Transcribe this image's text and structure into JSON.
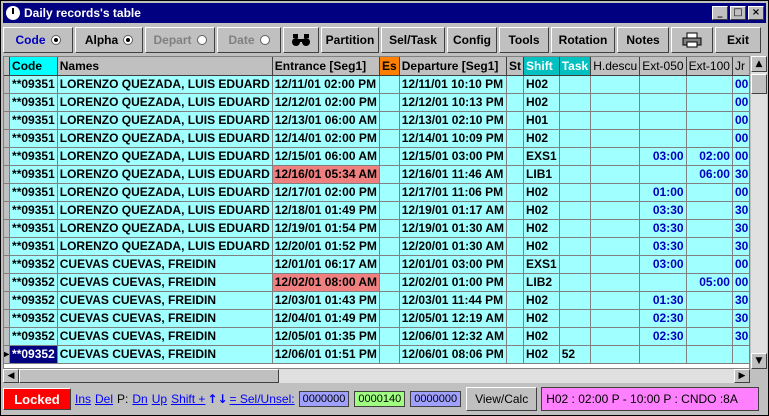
{
  "window": {
    "title": "Daily records's table",
    "min": "_",
    "max": "□",
    "close": "×"
  },
  "toolbar": {
    "code": "Code",
    "alpha": "Alpha",
    "depart": "Depart",
    "date": "Date",
    "partition": "Partition",
    "seltask": "Sel/Task",
    "config": "Config",
    "tools": "Tools",
    "rotation": "Rotation",
    "notes": "Notes",
    "exit": "Exit"
  },
  "columns": [
    "Code",
    "Names",
    "Entrance  [Seg1]",
    "Es",
    "Departure [Seg1]",
    "St",
    "Shift",
    "Task",
    "H.descu",
    "Ext-050",
    "Ext-100",
    "Jr"
  ],
  "rows": [
    {
      "code": "**09351",
      "name": "LORENZO QUEZADA, LUIS EDUARD",
      "entrance": "12/11/01 02:00 PM",
      "departure": "12/11/01 10:10 PM",
      "shift": "H02",
      "task": "",
      "ext050": "",
      "ext100": "",
      "jr": "00"
    },
    {
      "code": "**09351",
      "name": "LORENZO QUEZADA, LUIS EDUARD",
      "entrance": "12/12/01 02:00 PM",
      "departure": "12/12/01 10:13 PM",
      "shift": "H02",
      "task": "",
      "ext050": "",
      "ext100": "",
      "jr": "00"
    },
    {
      "code": "**09351",
      "name": "LORENZO QUEZADA, LUIS EDUARD",
      "entrance": "12/13/01 06:00 AM",
      "departure": "12/13/01 02:10 PM",
      "shift": "H01",
      "task": "",
      "ext050": "",
      "ext100": "",
      "jr": "00"
    },
    {
      "code": "**09351",
      "name": "LORENZO QUEZADA, LUIS EDUARD",
      "entrance": "12/14/01 02:00 PM",
      "departure": "12/14/01 10:09 PM",
      "shift": "H02",
      "task": "",
      "ext050": "",
      "ext100": "",
      "jr": "00"
    },
    {
      "code": "**09351",
      "name": "LORENZO QUEZADA, LUIS EDUARD",
      "entrance": "12/15/01 06:00 AM",
      "departure": "12/15/01 03:00 PM",
      "shift": "EXS1",
      "task": "",
      "ext050": "03:00",
      "ext100": "02:00",
      "jr": "00"
    },
    {
      "code": "**09351",
      "name": "LORENZO QUEZADA, LUIS EDUARD",
      "entrance": "12/16/01 05:34 AM",
      "entrance_alert": true,
      "departure": "12/16/01 11:46 AM",
      "shift": "LIB1",
      "task": "",
      "ext050": "",
      "ext100": "06:00",
      "jr": "30"
    },
    {
      "code": "**09351",
      "name": "LORENZO QUEZADA, LUIS EDUARD",
      "entrance": "12/17/01 02:00 PM",
      "departure": "12/17/01 11:06 PM",
      "shift": "H02",
      "task": "",
      "ext050": "01:00",
      "ext100": "",
      "jr": "00"
    },
    {
      "code": "**09351",
      "name": "LORENZO QUEZADA, LUIS EDUARD",
      "entrance": "12/18/01 01:49 PM",
      "departure": "12/19/01 01:17 AM",
      "shift": "H02",
      "task": "",
      "ext050": "03:30",
      "ext100": "",
      "jr": "30"
    },
    {
      "code": "**09351",
      "name": "LORENZO QUEZADA, LUIS EDUARD",
      "entrance": "12/19/01 01:54 PM",
      "departure": "12/19/01 01:30 AM",
      "shift": "H02",
      "task": "",
      "ext050": "03:30",
      "ext100": "",
      "jr": "30"
    },
    {
      "code": "**09351",
      "name": "LORENZO QUEZADA, LUIS EDUARD",
      "entrance": "12/20/01 01:52 PM",
      "departure": "12/20/01 01:30 AM",
      "shift": "H02",
      "task": "",
      "ext050": "03:30",
      "ext100": "",
      "jr": "30"
    },
    {
      "code": "**09352",
      "name": "CUEVAS CUEVAS, FREIDIN",
      "entrance": "12/01/01 06:17 AM",
      "departure": "12/01/01 03:00 PM",
      "shift": "EXS1",
      "task": "",
      "ext050": "03:00",
      "ext100": "",
      "jr": "00"
    },
    {
      "code": "**09352",
      "name": "CUEVAS CUEVAS, FREIDIN",
      "entrance": "12/02/01 08:00 AM",
      "entrance_alert": true,
      "departure": "12/02/01 01:00 PM",
      "shift": "LIB2",
      "task": "",
      "ext050": "",
      "ext100": "05:00",
      "jr": "00"
    },
    {
      "code": "**09352",
      "name": "CUEVAS CUEVAS, FREIDIN",
      "entrance": "12/03/01 01:43 PM",
      "departure": "12/03/01 11:44 PM",
      "shift": "H02",
      "task": "",
      "ext050": "01:30",
      "ext100": "",
      "jr": "30"
    },
    {
      "code": "**09352",
      "name": "CUEVAS CUEVAS, FREIDIN",
      "entrance": "12/04/01 01:49 PM",
      "departure": "12/05/01 12:19 AM",
      "shift": "H02",
      "task": "",
      "ext050": "02:30",
      "ext100": "",
      "jr": "30"
    },
    {
      "code": "**09352",
      "name": "CUEVAS CUEVAS, FREIDIN",
      "entrance": "12/05/01 01:35 PM",
      "departure": "12/06/01 12:32 AM",
      "shift": "H02",
      "task": "",
      "ext050": "02:30",
      "ext100": "",
      "jr": "30"
    },
    {
      "code": "**09352",
      "name": "CUEVAS CUEVAS, FREIDIN",
      "entrance": "12/06/01 01:51 PM",
      "departure": "12/06/01 08:06 PM",
      "shift": "H02",
      "task": "52",
      "ext050": "",
      "ext100": "",
      "jr": "",
      "selected": true
    }
  ],
  "status": {
    "locked": "Locked",
    "ins": "Ins",
    "del": "Del",
    "p_label": "P:",
    "dn": "Dn",
    "up": "Up",
    "shift": "Shift +",
    "arrows": "↑↓",
    "sel_unsel": "= Sel/Unsel:",
    "count1": "0000000",
    "count2": "0000140",
    "count3": "0000000",
    "viewcalc": "View/Calc",
    "info": "H02 : 02:00 P - 10:00 P : CNDO :8A"
  }
}
